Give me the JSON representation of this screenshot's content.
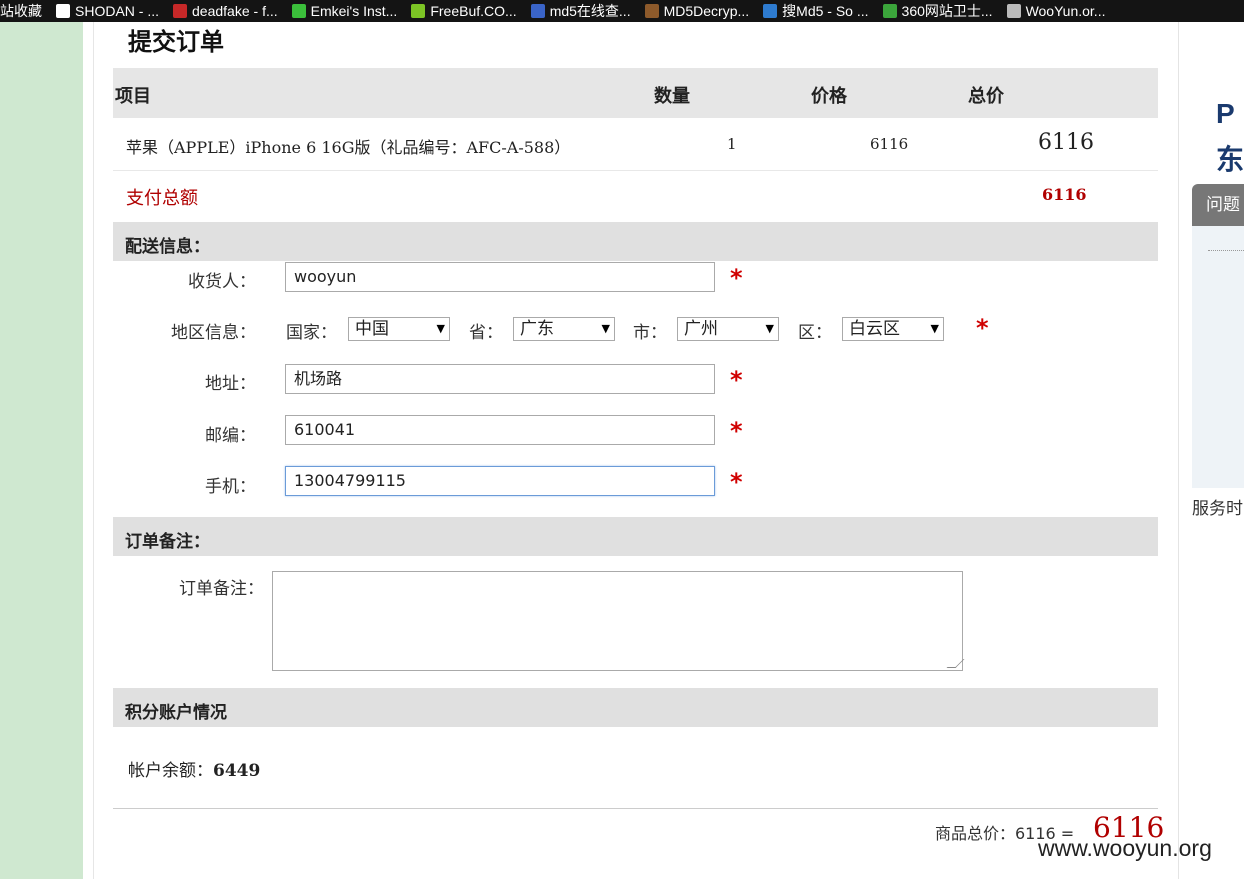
{
  "bookmarks": [
    {
      "label": "站收藏",
      "icon": "bookmark-star-icon",
      "color": "#141414"
    },
    {
      "label": "SHODAN - ...",
      "icon": "page-icon",
      "color": "#ffffff"
    },
    {
      "label": "deadfake - f...",
      "icon": "red-bars-icon",
      "color": "#c62828"
    },
    {
      "label": "Emkei's Inst...",
      "icon": "green-blob-icon",
      "color": "#3bbf3b"
    },
    {
      "label": "FreeBuf.CO...",
      "icon": "freebuf-f-icon",
      "color": "#7cc425"
    },
    {
      "label": "md5在线查...",
      "icon": "grid-icon",
      "color": "#3a64c8"
    },
    {
      "label": "MD5Decryp...",
      "icon": "figure-icon",
      "color": "#8d5a2b"
    },
    {
      "label": "搜Md5 - So ...",
      "icon": "globe-icon",
      "color": "#2e7bcf"
    },
    {
      "label": "360网站卫士...",
      "icon": "shield-icon",
      "color": "#3ba53b"
    },
    {
      "label": "WooYun.or...",
      "icon": "cloud-icon",
      "color": "#bbbbbb"
    }
  ],
  "page": {
    "title": "提交订单"
  },
  "table": {
    "headers": {
      "item": "项目",
      "qty": "数量",
      "price": "价格",
      "total": "总价"
    },
    "row": {
      "name": "苹果（APPLE）iPhone 6 16G版（礼品编号：AFC-A-588）",
      "qty": "1",
      "price": "6116",
      "total": "6116"
    },
    "pay_label": "支付总额",
    "pay_amount": "6116"
  },
  "shipping": {
    "section_title": "配送信息：",
    "recipient_label": "收货人：",
    "recipient_value": "wooyun",
    "region_label": "地区信息：",
    "country_label": "国家：",
    "country_value": "中国",
    "province_label": "省：",
    "province_value": "广东",
    "city_label": "市：",
    "city_value": "广州",
    "district_label": "区：",
    "district_value": "白云区",
    "address_label": "地址：",
    "address_value": "机场路",
    "zip_label": "邮编：",
    "zip_value": "610041",
    "phone_label": "手机：",
    "phone_value": "13004799115",
    "required_mark": "*"
  },
  "notes": {
    "section_title": "订单备注：",
    "label": "订单备注：",
    "value": ""
  },
  "points": {
    "section_title": "积分账户情况",
    "balance_label": "帐户余额：",
    "balance_value": "6449"
  },
  "summary": {
    "label": "商品总价：6116 =",
    "total": "6116"
  },
  "right_panel": {
    "logo_top": "P",
    "logo_bottom": "东",
    "tab_label": "问题",
    "service_label": "服务时"
  },
  "watermark": "www.wooyun.org",
  "colors": {
    "accent_red": "#b00000",
    "required_red": "#d00000",
    "left_strip": "#cfe8d0",
    "header_gray": "#e6e6e6"
  }
}
